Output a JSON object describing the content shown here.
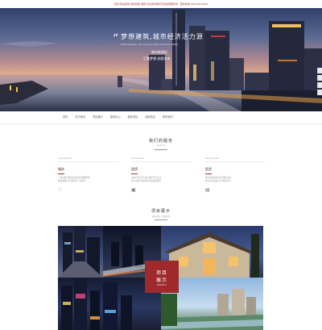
{
  "topbar": {
    "notice": "您好!欢迎来到 城市建筑 官网,专业商务楼宇空间运营服务商 · 服务热线 400-000-0000"
  },
  "hero": {
    "quote_mark": "“",
    "headline": "梦想建筑,城市经济活力源",
    "subline": "Dream building · the source of urban economic vitality",
    "caption1": "城市新地标",
    "caption2": "汇聚梦想,成就未来"
  },
  "nav": {
    "items": [
      "首页",
      "关于我们",
      "项目展示",
      "新闻中心",
      "服务项目",
      "招商信息",
      "联系我们"
    ]
  },
  "services": {
    "title": "我们的服务",
    "subtitle": "Services",
    "cards": [
      {
        "en": "management",
        "title": "服务",
        "desc": "一站式楼宇物业运营管理,细致周到\n精益求精,用心服务每一位客户",
        "icon": "heart-icon",
        "icon_glyph": "♡"
      },
      {
        "en": "professional",
        "title": "租赁",
        "desc": "多种户型灵活分割,满足不同企业\n办公需求,专业团队全程跟进服务",
        "icon": "image-icon",
        "icon_glyph": "▣"
      },
      {
        "en": "development",
        "title": "投资",
        "desc": "整合城市资源,提升建筑价值\n助力企业发展,共享城市活力",
        "icon": "chart-icon",
        "icon_glyph": "▤"
      }
    ]
  },
  "projects": {
    "title": "项目展示",
    "subtitle": "城市建筑 · 经典案例",
    "badge_line1": "项目",
    "badge_line2": "展示",
    "badge_en": "PROJECTS"
  },
  "colors": {
    "accent": "#9e2a2b",
    "nav_text": "#666666"
  }
}
